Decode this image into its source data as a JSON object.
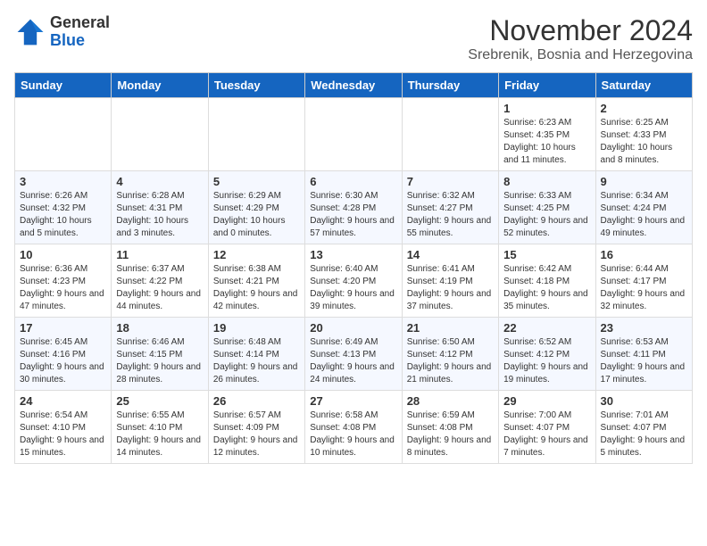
{
  "header": {
    "logo": {
      "general": "General",
      "blue": "Blue"
    },
    "title": "November 2024",
    "subtitle": "Srebrenik, Bosnia and Herzegovina"
  },
  "days_of_week": [
    "Sunday",
    "Monday",
    "Tuesday",
    "Wednesday",
    "Thursday",
    "Friday",
    "Saturday"
  ],
  "weeks": [
    [
      {
        "day": "",
        "info": ""
      },
      {
        "day": "",
        "info": ""
      },
      {
        "day": "",
        "info": ""
      },
      {
        "day": "",
        "info": ""
      },
      {
        "day": "",
        "info": ""
      },
      {
        "day": "1",
        "info": "Sunrise: 6:23 AM\nSunset: 4:35 PM\nDaylight: 10 hours and 11 minutes."
      },
      {
        "day": "2",
        "info": "Sunrise: 6:25 AM\nSunset: 4:33 PM\nDaylight: 10 hours and 8 minutes."
      }
    ],
    [
      {
        "day": "3",
        "info": "Sunrise: 6:26 AM\nSunset: 4:32 PM\nDaylight: 10 hours and 5 minutes."
      },
      {
        "day": "4",
        "info": "Sunrise: 6:28 AM\nSunset: 4:31 PM\nDaylight: 10 hours and 3 minutes."
      },
      {
        "day": "5",
        "info": "Sunrise: 6:29 AM\nSunset: 4:29 PM\nDaylight: 10 hours and 0 minutes."
      },
      {
        "day": "6",
        "info": "Sunrise: 6:30 AM\nSunset: 4:28 PM\nDaylight: 9 hours and 57 minutes."
      },
      {
        "day": "7",
        "info": "Sunrise: 6:32 AM\nSunset: 4:27 PM\nDaylight: 9 hours and 55 minutes."
      },
      {
        "day": "8",
        "info": "Sunrise: 6:33 AM\nSunset: 4:25 PM\nDaylight: 9 hours and 52 minutes."
      },
      {
        "day": "9",
        "info": "Sunrise: 6:34 AM\nSunset: 4:24 PM\nDaylight: 9 hours and 49 minutes."
      }
    ],
    [
      {
        "day": "10",
        "info": "Sunrise: 6:36 AM\nSunset: 4:23 PM\nDaylight: 9 hours and 47 minutes."
      },
      {
        "day": "11",
        "info": "Sunrise: 6:37 AM\nSunset: 4:22 PM\nDaylight: 9 hours and 44 minutes."
      },
      {
        "day": "12",
        "info": "Sunrise: 6:38 AM\nSunset: 4:21 PM\nDaylight: 9 hours and 42 minutes."
      },
      {
        "day": "13",
        "info": "Sunrise: 6:40 AM\nSunset: 4:20 PM\nDaylight: 9 hours and 39 minutes."
      },
      {
        "day": "14",
        "info": "Sunrise: 6:41 AM\nSunset: 4:19 PM\nDaylight: 9 hours and 37 minutes."
      },
      {
        "day": "15",
        "info": "Sunrise: 6:42 AM\nSunset: 4:18 PM\nDaylight: 9 hours and 35 minutes."
      },
      {
        "day": "16",
        "info": "Sunrise: 6:44 AM\nSunset: 4:17 PM\nDaylight: 9 hours and 32 minutes."
      }
    ],
    [
      {
        "day": "17",
        "info": "Sunrise: 6:45 AM\nSunset: 4:16 PM\nDaylight: 9 hours and 30 minutes."
      },
      {
        "day": "18",
        "info": "Sunrise: 6:46 AM\nSunset: 4:15 PM\nDaylight: 9 hours and 28 minutes."
      },
      {
        "day": "19",
        "info": "Sunrise: 6:48 AM\nSunset: 4:14 PM\nDaylight: 9 hours and 26 minutes."
      },
      {
        "day": "20",
        "info": "Sunrise: 6:49 AM\nSunset: 4:13 PM\nDaylight: 9 hours and 24 minutes."
      },
      {
        "day": "21",
        "info": "Sunrise: 6:50 AM\nSunset: 4:12 PM\nDaylight: 9 hours and 21 minutes."
      },
      {
        "day": "22",
        "info": "Sunrise: 6:52 AM\nSunset: 4:12 PM\nDaylight: 9 hours and 19 minutes."
      },
      {
        "day": "23",
        "info": "Sunrise: 6:53 AM\nSunset: 4:11 PM\nDaylight: 9 hours and 17 minutes."
      }
    ],
    [
      {
        "day": "24",
        "info": "Sunrise: 6:54 AM\nSunset: 4:10 PM\nDaylight: 9 hours and 15 minutes."
      },
      {
        "day": "25",
        "info": "Sunrise: 6:55 AM\nSunset: 4:10 PM\nDaylight: 9 hours and 14 minutes."
      },
      {
        "day": "26",
        "info": "Sunrise: 6:57 AM\nSunset: 4:09 PM\nDaylight: 9 hours and 12 minutes."
      },
      {
        "day": "27",
        "info": "Sunrise: 6:58 AM\nSunset: 4:08 PM\nDaylight: 9 hours and 10 minutes."
      },
      {
        "day": "28",
        "info": "Sunrise: 6:59 AM\nSunset: 4:08 PM\nDaylight: 9 hours and 8 minutes."
      },
      {
        "day": "29",
        "info": "Sunrise: 7:00 AM\nSunset: 4:07 PM\nDaylight: 9 hours and 7 minutes."
      },
      {
        "day": "30",
        "info": "Sunrise: 7:01 AM\nSunset: 4:07 PM\nDaylight: 9 hours and 5 minutes."
      }
    ]
  ]
}
